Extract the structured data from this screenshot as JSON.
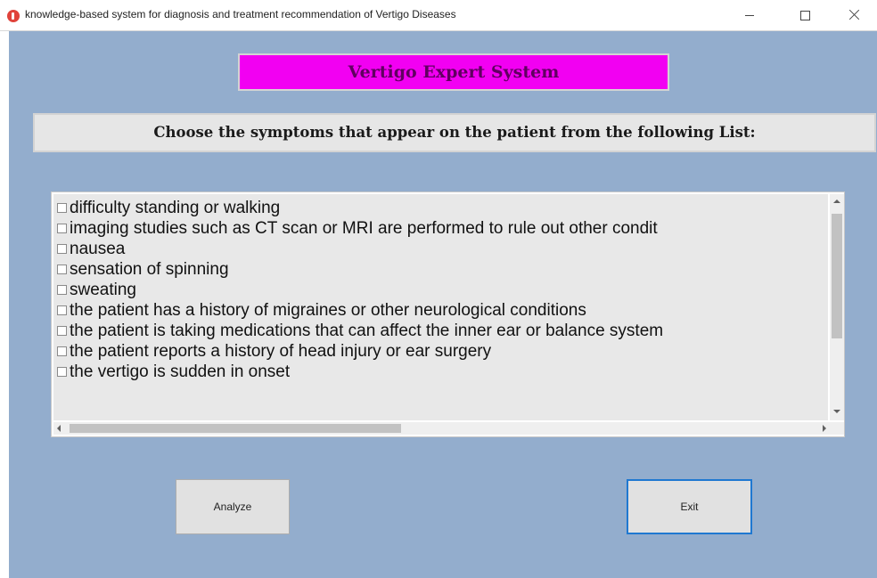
{
  "window": {
    "title": "knowledge-based system for diagnosis and treatment recommendation of Vertigo Diseases",
    "icon": "app-stop-icon",
    "controls": {
      "minimize": "minimize-icon",
      "maximize": "maximize-icon",
      "close": "close-icon"
    }
  },
  "header": {
    "title": "Vertigo Expert System",
    "color": "#f200f2"
  },
  "instruction": {
    "text": "Choose the symptoms that appear on the patient  from the following List:"
  },
  "symptoms": {
    "items": [
      {
        "label": "difficulty standing or walking",
        "checked": false
      },
      {
        "label": "imaging studies such as CT scan or MRI are performed to rule out other condit",
        "checked": false
      },
      {
        "label": "nausea",
        "checked": false
      },
      {
        "label": "sensation of spinning",
        "checked": false
      },
      {
        "label": "sweating",
        "checked": false
      },
      {
        "label": "the patient has a history of migraines or other neurological conditions",
        "checked": false
      },
      {
        "label": "the patient is taking medications that can affect the inner ear or balance system",
        "checked": false
      },
      {
        "label": "the patient reports a history of head injury or ear surgery",
        "checked": false
      },
      {
        "label": "the vertigo is  sudden in onset",
        "checked": false
      }
    ]
  },
  "buttons": {
    "analyze_label": "Analyze",
    "exit_label": "Exit"
  },
  "colors": {
    "background": "#93adcd",
    "focus_border": "#1f78d1"
  }
}
